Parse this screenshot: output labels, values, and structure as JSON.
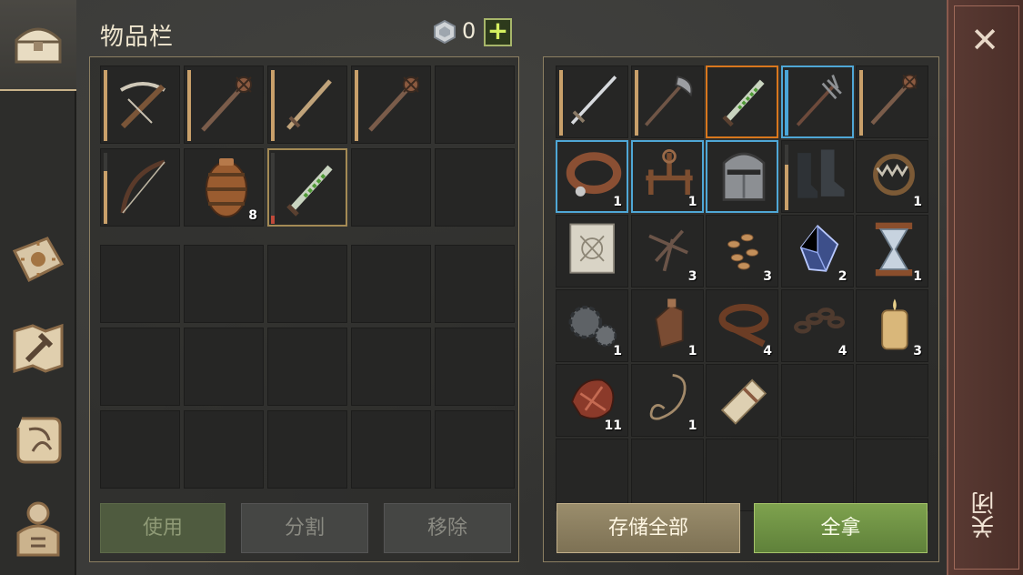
{
  "header": {
    "title": "物品栏",
    "currency_count": "0",
    "plus_label": "+"
  },
  "left_panel": {
    "items": [
      {
        "icon": "crossbow-icon",
        "qty": ""
      },
      {
        "icon": "mace-icon",
        "qty": ""
      },
      {
        "icon": "sword-icon",
        "qty": ""
      },
      {
        "icon": "mace-icon",
        "qty": ""
      },
      {
        "icon": "",
        "qty": ""
      },
      {
        "icon": "bow-icon",
        "qty": ""
      },
      {
        "icon": "barrel-icon",
        "qty": "8"
      },
      {
        "icon": "poisoned-dagger-icon",
        "qty": ""
      }
    ]
  },
  "right_panel": {
    "items": [
      {
        "icon": "longsword-icon",
        "qty": ""
      },
      {
        "icon": "halberd-icon",
        "qty": ""
      },
      {
        "icon": "poisoned-dagger-icon",
        "qty": ""
      },
      {
        "icon": "trident-icon",
        "qty": ""
      },
      {
        "icon": "mace-icon",
        "qty": ""
      },
      {
        "icon": "collar-icon",
        "qty": "1"
      },
      {
        "icon": "stocks-icon",
        "qty": "1"
      },
      {
        "icon": "great-helm-icon",
        "qty": ""
      },
      {
        "icon": "boots-icon",
        "qty": ""
      },
      {
        "icon": "bear-trap-icon",
        "qty": "1"
      },
      {
        "icon": "blueprint-icon",
        "qty": ""
      },
      {
        "icon": "nails-icon",
        "qty": "3"
      },
      {
        "icon": "seeds-icon",
        "qty": "3"
      },
      {
        "icon": "crystal-icon",
        "qty": "2"
      },
      {
        "icon": "hourglass-icon",
        "qty": "1"
      },
      {
        "icon": "gears-icon",
        "qty": "1"
      },
      {
        "icon": "bottle-icon",
        "qty": "1"
      },
      {
        "icon": "leather-icon",
        "qty": "4"
      },
      {
        "icon": "chain-icon",
        "qty": "4"
      },
      {
        "icon": "candle-icon",
        "qty": "3"
      },
      {
        "icon": "meat-icon",
        "qty": "11"
      },
      {
        "icon": "rope-icon",
        "qty": "1"
      },
      {
        "icon": "scroll-icon",
        "qty": ""
      }
    ]
  },
  "buttons": {
    "use": "使用",
    "split": "分割",
    "remove": "移除",
    "store_all": "存储全部",
    "take_all": "全拿"
  },
  "close": {
    "label": "关闭",
    "x": "✕"
  },
  "colors": {
    "rare_orange": "#d9771d",
    "blue_frame": "#4fa7d6",
    "take_green": "#6e9444"
  }
}
